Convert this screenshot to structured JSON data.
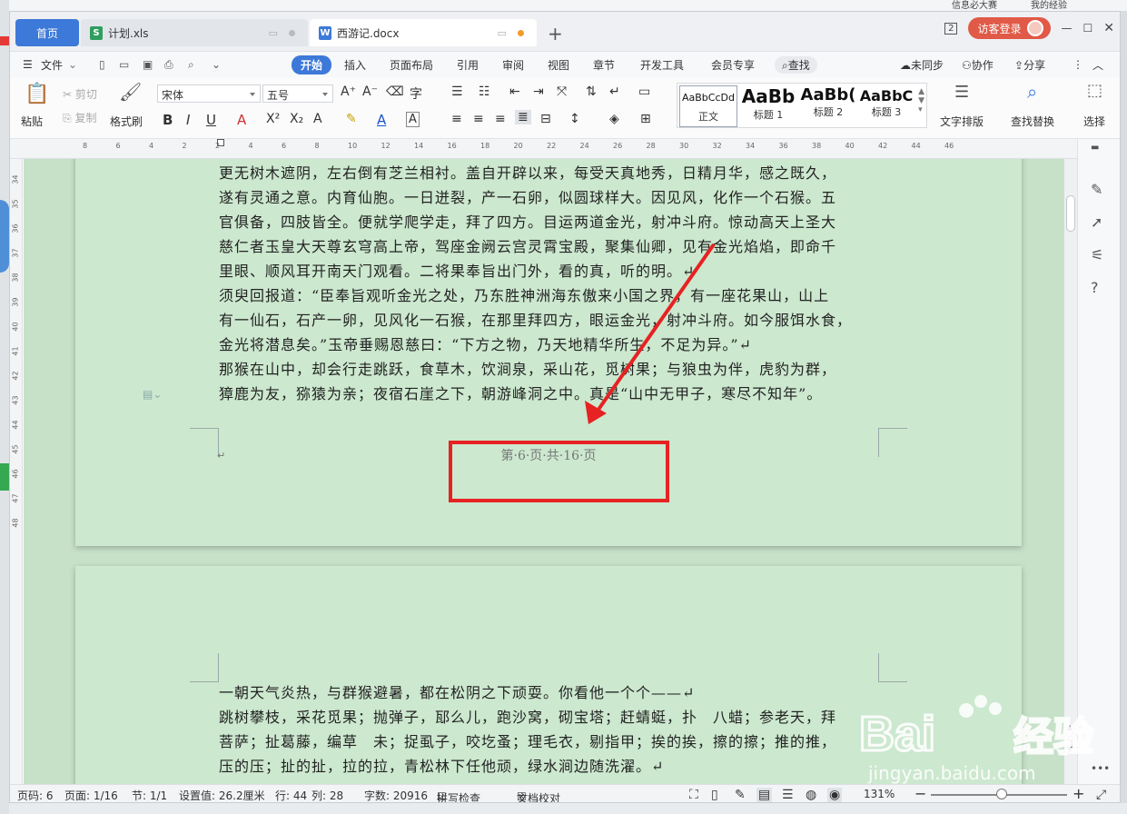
{
  "tabs": {
    "home": "首页",
    "file1": "计划.xls",
    "file2": "西游记.docx",
    "add": "+"
  },
  "header": {
    "login": "访客登录",
    "badge": "2"
  },
  "menu": {
    "file": "文件",
    "items": [
      "开始",
      "插入",
      "页面布局",
      "引用",
      "审阅",
      "视图",
      "章节",
      "开发工具",
      "会员专享"
    ],
    "search": "查找",
    "sync": "未同步",
    "collab": "协作",
    "share": "分享"
  },
  "ribbon": {
    "paste": "粘贴",
    "cut": "剪切",
    "copy": "复制",
    "format_painter": "格式刷",
    "font": "宋体",
    "size": "五号",
    "styles": [
      {
        "preview": "AaBbCcDd",
        "name": "正文"
      },
      {
        "preview": "AaBb",
        "name": "标题 1"
      },
      {
        "preview": "AaBb(",
        "name": "标题 2"
      },
      {
        "preview": "AaBbC",
        "name": "标题 3"
      }
    ],
    "text_layout": "文字排版",
    "find_replace": "查找替换",
    "select": "选择"
  },
  "ruler": {
    "h": [
      "8",
      "6",
      "4",
      "2",
      "2",
      "4",
      "6",
      "8",
      "10",
      "12",
      "14",
      "16",
      "18",
      "20",
      "22",
      "24",
      "26",
      "28",
      "30",
      "32",
      "34",
      "36",
      "38",
      "40",
      "42",
      "44",
      "46"
    ],
    "v": [
      "34",
      "35",
      "36",
      "37",
      "38",
      "39",
      "40",
      "41",
      "42",
      "43",
      "44",
      "45",
      "46",
      "47",
      "48"
    ]
  },
  "document": {
    "page1_lines": [
      "更无树木遮阴，左右倒有芝兰相衬。盖自开辟以来，每受天真地秀，日精月华，感之既久，",
      "遂有灵通之意。内育仙胞。一日迸裂，产一石卵，似圆球样大。因见风，化作一个石猴。五",
      "官俱备，四肢皆全。便就学爬学走，拜了四方。目运两道金光，射冲斗府。惊动高天上圣大",
      "慈仁者玉皇大天尊玄穹高上帝，驾座金阙云宫灵霄宝殿，聚集仙卿，见有金光焰焰，即命千",
      "里眼、顺风耳开南天门观看。二将果奉旨出门外，看的真，听的明。↵",
      "须臾回报道：“臣奉旨观听金光之处，乃东胜神洲海东傲来小国之界，有一座花果山，山上",
      "有一仙石，石产一卵，见风化一石猴，在那里拜四方，眼运金光，射冲斗府。如今服饵水食，",
      "金光将潜息矣。”玉帝垂赐恩慈曰：“下方之物，乃天地精华所生，不足为异。”↵",
      "那猴在山中，却会行走跳跃，食草木，饮涧泉，采山花，觅树果；与狼虫为伴，虎豹为群，",
      "獐鹿为友，猕猿为亲；夜宿石崖之下，朝游峰洞之中。真是“山中无甲子，寒尽不知年”。"
    ],
    "footer": "第·6·页·共·16·页",
    "page2_lines": [
      "一朝天气炎热，与群猴避暑，都在松阴之下顽耍。你看他一个个——↵",
      "跳树攀枝，采花觅果；抛弹子，邷么儿，跑沙窝，砌宝塔；赶蜻蜓，扑　八蜡；参老天，拜",
      "菩萨；扯葛藤，编草　未；捉虱子，咬圪蚤；理毛衣，剔指甲；挨的挨，擦的擦；推的推，",
      "压的压；扯的扯，拉的拉，青松林下任他顽，绿水涧边随洗濯。↵"
    ]
  },
  "status": {
    "page_code": "页码: 6",
    "page": "页面: 1/16",
    "section": "节: 1/1",
    "setting": "设置值: 26.2厘米",
    "row": "行: 44",
    "col": "列: 28",
    "words": "字数: 20916",
    "spell": "拼写检查",
    "proof": "文档校对",
    "zoom": "131%"
  },
  "watermark": {
    "brand": "Bai",
    "brand2": "经验",
    "url": "jingyan.baidu.com"
  },
  "colors": {
    "accent": "#3d79d8",
    "page_bg": "#cce8cf",
    "highlight": "#e62222",
    "login": "#e05a47"
  }
}
